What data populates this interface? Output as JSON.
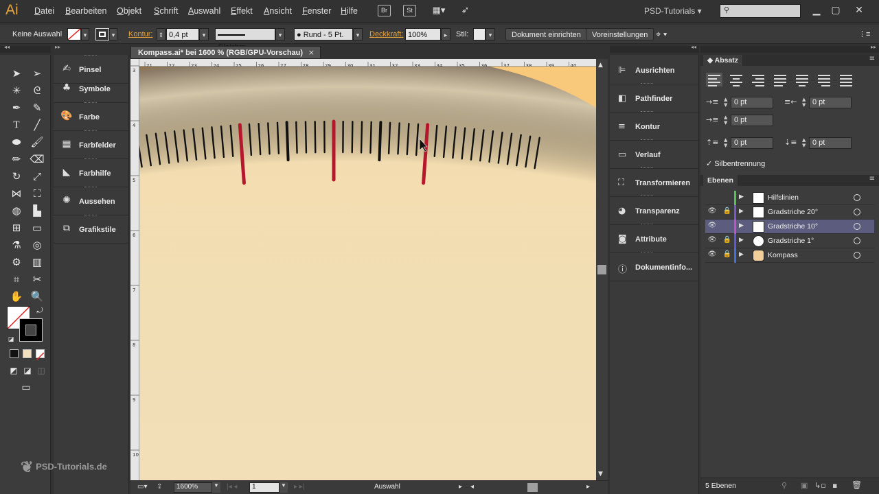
{
  "app": {
    "logo": "Ai",
    "workspace": "PSD-Tutorials"
  },
  "menu": [
    "Datei",
    "Bearbeiten",
    "Objekt",
    "Schrift",
    "Auswahl",
    "Effekt",
    "Ansicht",
    "Fenster",
    "Hilfe"
  ],
  "menu_buttons": [
    "Br",
    "St"
  ],
  "control": {
    "selection": "Keine Auswahl",
    "stroke_label": "Kontur:",
    "stroke_value": "0,4 pt",
    "profile": "Gleichm.",
    "brush": "Rund - 5 Pt.",
    "opacity_label": "Deckkraft:",
    "opacity_value": "100%",
    "style_label": "Stil:",
    "doc_setup": "Dokument einrichten",
    "preferences": "Voreinstellungen"
  },
  "document": {
    "tab": "Kompass.ai* bei 1600 % (RGB/GPU-Vorschau)",
    "close": "×"
  },
  "ruler_top": [
    "21",
    "22",
    "23",
    "24",
    "25",
    "26",
    "27",
    "28",
    "29",
    "30",
    "31",
    "32",
    "33",
    "34",
    "35",
    "36",
    "37",
    "38",
    "39",
    "40"
  ],
  "ruler_left": [
    "3",
    "4",
    "5",
    "6",
    "7",
    "8",
    "9",
    "10"
  ],
  "status": {
    "zoom": "1600%",
    "artboard": "1",
    "tool": "Auswahl"
  },
  "left_panels": [
    "Pinsel",
    "Symbole",
    "Farbe",
    "Farbfelder",
    "Farbhilfe",
    "Aussehen",
    "Grafikstile"
  ],
  "mid_panels": [
    "Ausrichten",
    "Pathfinder",
    "Kontur",
    "Verlauf",
    "Transformieren",
    "Transparenz",
    "Attribute",
    "Dokumentinfo..."
  ],
  "absatz": {
    "title": "Absatz",
    "indent_left": "0 pt",
    "indent_right": "0 pt",
    "first_line": "0 pt",
    "space_before": "0 pt",
    "space_after": "0 pt",
    "hyphenation": "Silbentrennung"
  },
  "layers_panel": {
    "title": "Ebenen",
    "count": "5 Ebenen",
    "layers": [
      {
        "name": "Hilfslinien",
        "color": "#4fc24f",
        "eye": "",
        "lock": "",
        "selected": false
      },
      {
        "name": "Gradstriche 20°",
        "color": "#7a55d0",
        "eye": "👁",
        "lock": "🔒",
        "selected": false
      },
      {
        "name": "Gradstriche 10°",
        "color": "#c450c4",
        "eye": "👁",
        "lock": "",
        "selected": true
      },
      {
        "name": "Gradstriche 1°",
        "color": "#5a5ad8",
        "eye": "👁",
        "lock": "🔒",
        "selected": false
      },
      {
        "name": "Kompass",
        "color": "#3f6fe0",
        "eye": "👁",
        "lock": "🔒",
        "selected": false
      }
    ]
  },
  "watermark": "PSD-Tutorials.de",
  "colors": {
    "accent": "#e8a33c",
    "tick_red": "#b5182c",
    "tick_black": "#111111",
    "dial": "#f1ddb0",
    "rim": "#9a6a22"
  }
}
